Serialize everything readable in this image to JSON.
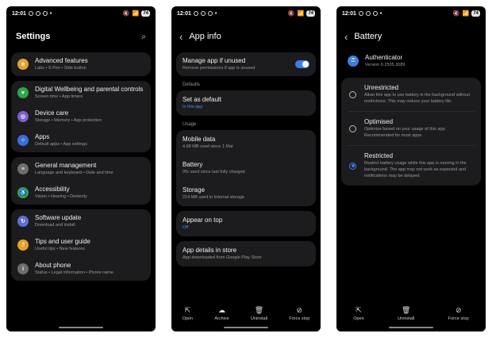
{
  "status": {
    "time": "12:01",
    "battery": "74"
  },
  "settings": {
    "title": "Settings",
    "groups": [
      [
        {
          "title": "Advanced features",
          "sub": "Labs  •  S Pen  •  Side button",
          "color": "#e6a02a",
          "icon": "star-icon"
        }
      ],
      [
        {
          "title": "Digital Wellbeing and parental controls",
          "sub": "Screen time  •  App timers",
          "color": "#2fa64a",
          "icon": "wellbeing-icon"
        },
        {
          "title": "Device care",
          "sub": "Storage  •  Memory  •  App protection",
          "color": "#7b5fd0",
          "icon": "device-care-icon"
        },
        {
          "title": "Apps",
          "sub": "Default apps  •  App settings",
          "color": "#3a6fd8",
          "icon": "apps-icon"
        }
      ],
      [
        {
          "title": "General management",
          "sub": "Language and keyboard  •  Date and time",
          "color": "#6e6e6e",
          "icon": "sliders-icon"
        },
        {
          "title": "Accessibility",
          "sub": "Vision  •  Hearing  •  Dexterity",
          "color": "#2fa64a",
          "icon": "accessibility-icon"
        }
      ],
      [
        {
          "title": "Software update",
          "sub": "Download and install",
          "color": "#5b6fd8",
          "icon": "update-icon"
        },
        {
          "title": "Tips and user guide",
          "sub": "Useful tips  •  New features",
          "color": "#e6a02a",
          "icon": "tips-icon"
        },
        {
          "title": "About phone",
          "sub": "Status  •  Legal information  •  Phone name",
          "color": "#6e6e6e",
          "icon": "info-icon"
        }
      ]
    ]
  },
  "appinfo": {
    "title": "App info",
    "manage": {
      "title": "Manage app if unused",
      "sub": "Remove permissions if app is unused"
    },
    "defaults_label": "Defaults",
    "set_default": {
      "title": "Set as default",
      "sub": "In this app"
    },
    "usage_label": "Usage",
    "usage": [
      {
        "title": "Mobile data",
        "sub": "4.68 MB used since 1 Mar"
      },
      {
        "title": "Battery",
        "sub": "0% used since last fully charged"
      },
      {
        "title": "Storage",
        "sub": "214 MB used in Internal storage"
      }
    ],
    "appear": {
      "title": "Appear on top",
      "sub": "Off"
    },
    "store": {
      "title": "App details in store",
      "sub": "App downloaded from Google Play Store"
    },
    "bar": [
      {
        "label": "Open",
        "glyph": "⇱"
      },
      {
        "label": "Archive",
        "glyph": "☁"
      },
      {
        "label": "Uninstall",
        "glyph": "🗑"
      },
      {
        "label": "Force stop",
        "glyph": "⊘"
      }
    ]
  },
  "battery": {
    "title": "Battery",
    "app_name": "Authenticator",
    "app_version": "Version 6.2505.3089",
    "options": [
      {
        "title": "Unrestricted",
        "sub": "Allow this app to use battery in the background without restrictions. This may reduce your battery life.",
        "selected": false
      },
      {
        "title": "Optimised",
        "sub": "Optimise based on your usage of this app. Recommended for most apps.",
        "selected": false
      },
      {
        "title": "Restricted",
        "sub": "Restrict battery usage while this app is running in the background. The app may not work as expected and notifications may be delayed.",
        "selected": true
      }
    ],
    "bar": [
      {
        "label": "Open",
        "glyph": "⇱"
      },
      {
        "label": "Uninstall",
        "glyph": "🗑"
      },
      {
        "label": "Force stop",
        "glyph": "⊘"
      }
    ]
  }
}
